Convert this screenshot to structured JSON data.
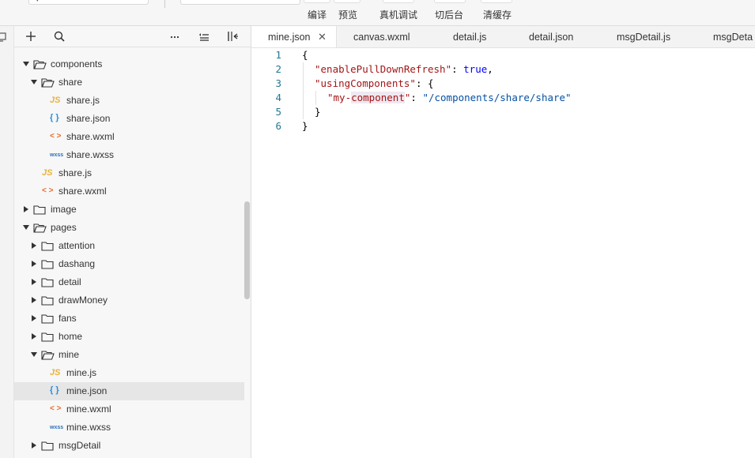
{
  "toolbar": {
    "tools": [
      {
        "id": "compile",
        "label": "编译"
      },
      {
        "id": "preview",
        "label": "预览"
      },
      {
        "id": "remote-debug",
        "label": "真机调试"
      },
      {
        "id": "background",
        "label": "切后台"
      },
      {
        "id": "clear-cache",
        "label": "清缓存"
      }
    ]
  },
  "explorer": {
    "tree": [
      {
        "label": "components",
        "type": "folder",
        "depth": 0,
        "expanded": true
      },
      {
        "label": "share",
        "type": "folder",
        "depth": 1,
        "expanded": true
      },
      {
        "label": "share.js",
        "type": "js",
        "depth": 2
      },
      {
        "label": "share.json",
        "type": "json",
        "depth": 2
      },
      {
        "label": "share.wxml",
        "type": "wxml",
        "depth": 2
      },
      {
        "label": "share.wxss",
        "type": "wxss",
        "depth": 2
      },
      {
        "label": "share.js",
        "type": "js",
        "depth": 1
      },
      {
        "label": "share.wxml",
        "type": "wxml",
        "depth": 1
      },
      {
        "label": "image",
        "type": "folder",
        "depth": 0,
        "expanded": false
      },
      {
        "label": "pages",
        "type": "folder",
        "depth": 0,
        "expanded": true
      },
      {
        "label": "attention",
        "type": "folder",
        "depth": 1,
        "expanded": false
      },
      {
        "label": "dashang",
        "type": "folder",
        "depth": 1,
        "expanded": false
      },
      {
        "label": "detail",
        "type": "folder",
        "depth": 1,
        "expanded": false
      },
      {
        "label": "drawMoney",
        "type": "folder",
        "depth": 1,
        "expanded": false
      },
      {
        "label": "fans",
        "type": "folder",
        "depth": 1,
        "expanded": false
      },
      {
        "label": "home",
        "type": "folder",
        "depth": 1,
        "expanded": false
      },
      {
        "label": "mine",
        "type": "folder",
        "depth": 1,
        "expanded": true
      },
      {
        "label": "mine.js",
        "type": "js",
        "depth": 2
      },
      {
        "label": "mine.json",
        "type": "json",
        "depth": 2,
        "selected": true
      },
      {
        "label": "mine.wxml",
        "type": "wxml",
        "depth": 2
      },
      {
        "label": "mine.wxss",
        "type": "wxss",
        "depth": 2
      },
      {
        "label": "msgDetail",
        "type": "folder",
        "depth": 1,
        "expanded": false
      }
    ],
    "icon_glyphs": {
      "js": "JS",
      "json": "{ }",
      "wxml": "< >",
      "wxss": "wxss"
    }
  },
  "editor": {
    "tabs": [
      {
        "label": "mine.json",
        "active": true
      },
      {
        "label": "canvas.wxml"
      },
      {
        "label": "detail.js"
      },
      {
        "label": "detail.json"
      },
      {
        "label": "msgDetail.js"
      },
      {
        "label": "msgDeta"
      }
    ],
    "close_glyph": "✕",
    "lines": [
      {
        "n": "1",
        "indent": 0,
        "tokens": [
          {
            "t": "{",
            "k": "punc"
          }
        ]
      },
      {
        "n": "2",
        "indent": 1,
        "tokens": [
          {
            "t": "\"enablePullDownRefresh\"",
            "k": "key"
          },
          {
            "t": ": ",
            "k": "punc"
          },
          {
            "t": "true",
            "k": "lit"
          },
          {
            "t": ",",
            "k": "punc"
          }
        ]
      },
      {
        "n": "3",
        "indent": 1,
        "tokens": [
          {
            "t": "\"usingComponents\"",
            "k": "key"
          },
          {
            "t": ": {",
            "k": "punc"
          }
        ]
      },
      {
        "n": "4",
        "indent": 2,
        "tokens": [
          {
            "t": "\"my-",
            "k": "key"
          },
          {
            "t": "component",
            "k": "key",
            "hl": true
          },
          {
            "t": "\"",
            "k": "key"
          },
          {
            "t": ": ",
            "k": "punc"
          },
          {
            "t": "\"/components/share/share\"",
            "k": "str"
          }
        ]
      },
      {
        "n": "5",
        "indent": 1,
        "tokens": [
          {
            "t": "}",
            "k": "punc"
          }
        ]
      },
      {
        "n": "6",
        "indent": 0,
        "tokens": [
          {
            "t": "}",
            "k": "punc"
          }
        ]
      }
    ]
  },
  "colors": {
    "json_key": "#a31515",
    "json_string": "#0451a5",
    "json_literal": "#0000ff",
    "line_number": "#237893",
    "icon_js": "#e8b23a",
    "icon_json": "#2d8dd8",
    "icon_wxml": "#e8692a",
    "icon_wxss": "#2d6fbd"
  }
}
